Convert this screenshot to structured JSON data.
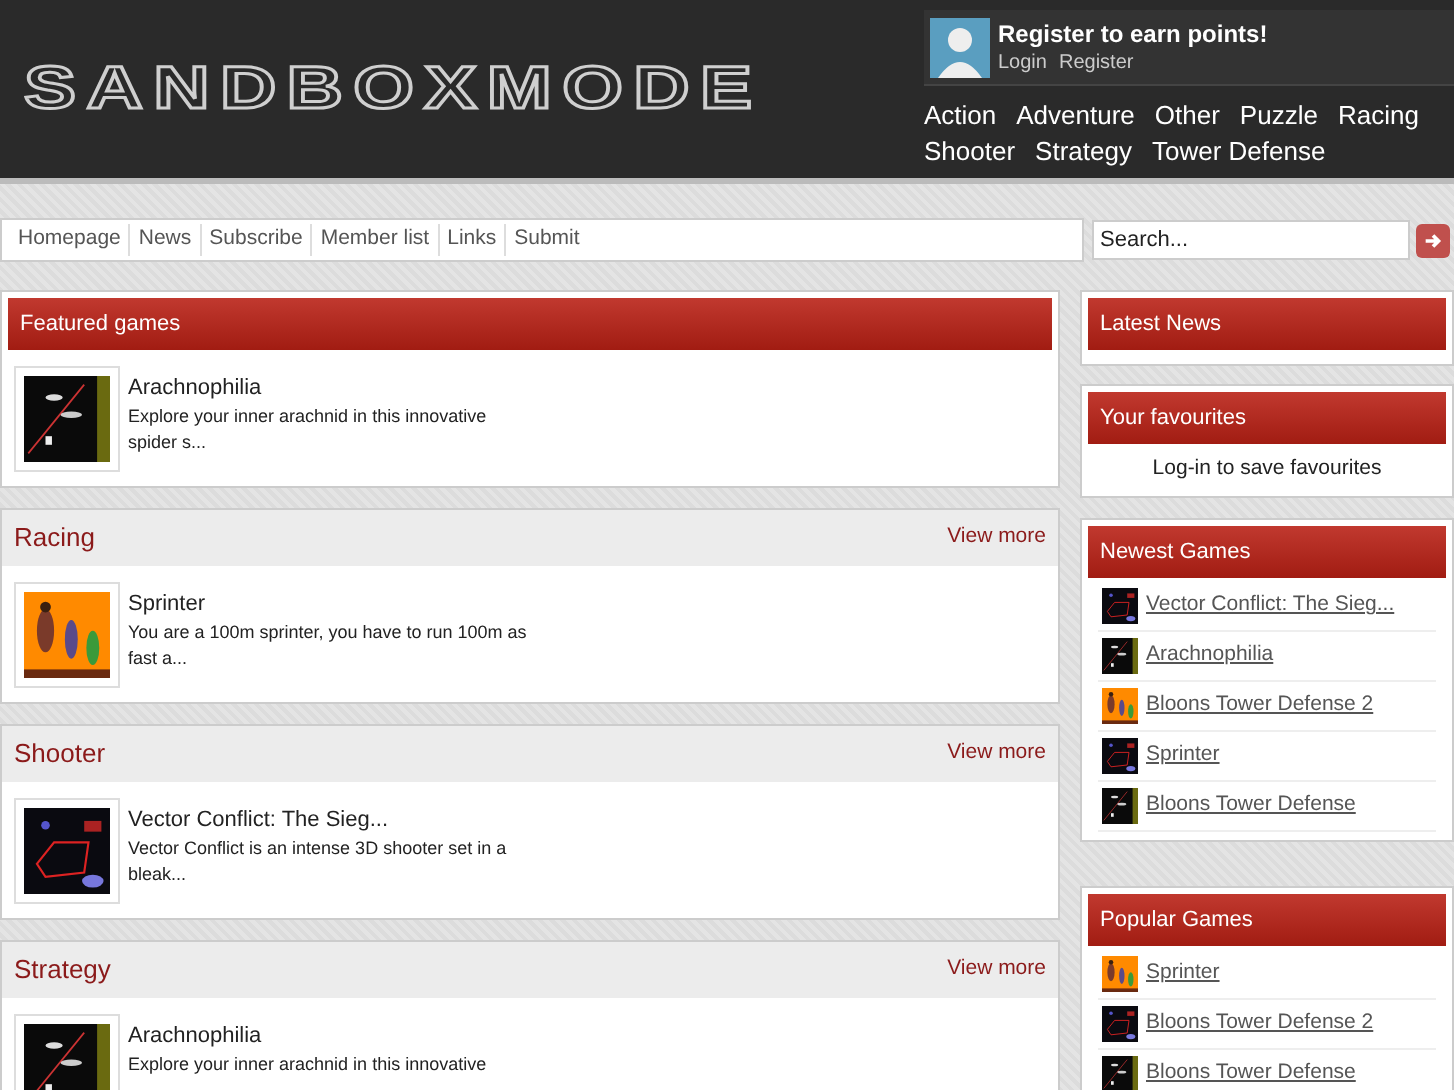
{
  "header": {
    "logo": "SANDBOXMODE",
    "user_panel": {
      "title": "Register to earn points!",
      "links": [
        "Login",
        "Register"
      ]
    },
    "categories": [
      "Action",
      "Adventure",
      "Other",
      "Puzzle",
      "Racing",
      "Shooter",
      "Strategy",
      "Tower Defense"
    ]
  },
  "nav": {
    "links": [
      "Homepage",
      "News",
      "Subscribe",
      "Member list",
      "Links",
      "Submit"
    ],
    "search": {
      "placeholder": "Search..."
    }
  },
  "featured": {
    "title": "Featured games",
    "games": [
      {
        "name": "Arachnophilia",
        "description": "Explore your inner arachnid in this innovative spider s..."
      }
    ]
  },
  "sections": [
    {
      "title": "Racing",
      "more": "View more",
      "games": [
        {
          "name": "Sprinter",
          "description": "You are a 100m sprinter, you have to run 100m as fast a..."
        }
      ]
    },
    {
      "title": "Shooter",
      "more": "View more",
      "games": [
        {
          "name": "Vector Conflict: The Sieg...",
          "description": "Vector Conflict is an intense 3D shooter set in a bleak..."
        }
      ]
    },
    {
      "title": "Strategy",
      "more": "View more",
      "games": [
        {
          "name": "Arachnophilia",
          "description": "Explore your inner arachnid in this innovative"
        }
      ]
    }
  ],
  "sidebar": {
    "latest_news": {
      "title": "Latest News"
    },
    "favourites": {
      "title": "Your favourites",
      "message": "Log-in to save favourites"
    },
    "newest_games": {
      "title": "Newest Games",
      "items": [
        "Vector Conflict: The Sieg...",
        "Arachnophilia",
        "Bloons Tower Defense 2",
        "Sprinter",
        "Bloons Tower Defense"
      ]
    },
    "popular_games": {
      "title": "Popular Games",
      "items": [
        "Sprinter",
        "Bloons Tower Defense 2",
        "Bloons Tower Defense"
      ]
    }
  }
}
